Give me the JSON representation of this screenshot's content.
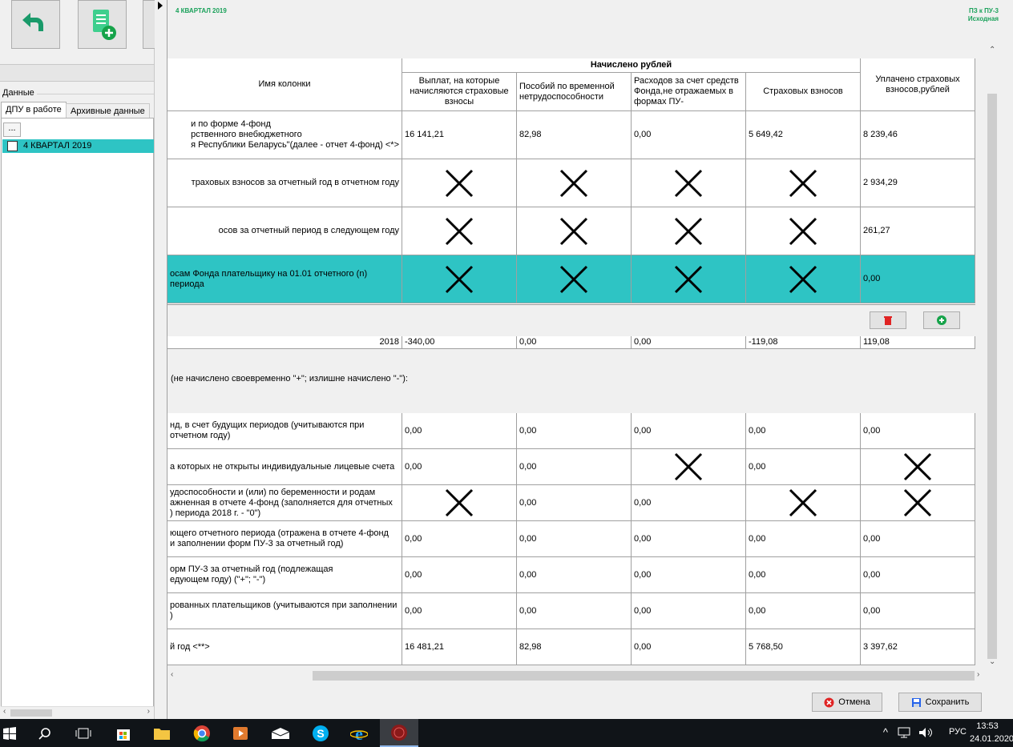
{
  "left_panel": {
    "data_label": "Данные",
    "tabs": [
      "ДПУ в работе",
      "Архивные данные"
    ],
    "tree_button": "...",
    "tree_items": [
      "4 КВАРТАЛ 2019"
    ]
  },
  "header": {
    "period": "4 КВАРТАЛ 2019",
    "form": "ПЗ к ПУ-3",
    "status": "Исходная"
  },
  "table": {
    "col_name": "Имя колонки",
    "group_header": "Начислено рублей",
    "columns": [
      "Выплат, на которые начисляются страховые взносы",
      "Пособий по временной нетрудоспособности",
      "Расходов за счет средств Фонда,не отражаемых в формах ПУ-",
      "Страховых взносов",
      "Уплачено страховых взносов,рублей"
    ],
    "top_rows": [
      {
        "name": "и по форме 4-фонд\nрственного внебюджетного\nя Республики Беларусь\"(далее - отчет 4-фонд) <*>",
        "v": [
          "16 141,21",
          "82,98",
          "0,00",
          "5 649,42",
          "8 239,46"
        ]
      },
      {
        "name": "траховых взносов за отчетный год в отчетном году",
        "v": [
          "X",
          "X",
          "X",
          "X",
          "2 934,29"
        ]
      },
      {
        "name": "осов за отчетный период в следующем году",
        "v": [
          "X",
          "X",
          "X",
          "X",
          "261,27"
        ]
      },
      {
        "name": "осам Фонда плательщику на 01.01 отчетного (n) периода",
        "v": [
          "X",
          "X",
          "X",
          "X",
          "0,00"
        ]
      }
    ],
    "insert_text": "(не начислено своевременно \"+\"; излишне начислено \"-\"):",
    "year_row": {
      "year": "2018",
      "v": [
        "-340,00",
        "0,00",
        "0,00",
        "-119,08",
        "119,08"
      ]
    },
    "bottom_rows": [
      {
        "name": "нд, в счет будущих периодов (учитываются при\nотчетном году)",
        "v": [
          "0,00",
          "0,00",
          "0,00",
          "0,00",
          "0,00"
        ]
      },
      {
        "name": "а которых не открыты индивидуальные лицевые счета",
        "v": [
          "0,00",
          "0,00",
          "X",
          "0,00",
          "X"
        ]
      },
      {
        "name": "удоспособности и (или) по беременности и родам\nажненная в отчете 4-фонд (заполняется для отчетных\n) периода 2018 г. - \"0\")",
        "v": [
          "X",
          "0,00",
          "0,00",
          "X",
          "X"
        ]
      },
      {
        "name": "ющего отчетного периода (отражена в отчете 4-фонд\nи заполнении форм ПУ-3 за отчетный год)",
        "v": [
          "0,00",
          "0,00",
          "0,00",
          "0,00",
          "0,00"
        ]
      },
      {
        "name": "орм ПУ-3 за отчетный год (подлежащая\nедующем году) (\"+\"; \"-\")",
        "v": [
          "0,00",
          "0,00",
          "0,00",
          "0,00",
          "0,00"
        ]
      },
      {
        "name": "рованных плательщиков (учитываются при заполнении\n)",
        "v": [
          "0,00",
          "0,00",
          "0,00",
          "0,00",
          "0,00"
        ]
      },
      {
        "name": "й год <**>",
        "v": [
          "16 481,21",
          "82,98",
          "0,00",
          "5 768,50",
          "3 397,62"
        ]
      }
    ]
  },
  "buttons": {
    "cancel": "Отмена",
    "save": "Сохранить"
  },
  "taskbar": {
    "lang": "РУС",
    "time": "13:53",
    "date": "24.01.2020"
  },
  "colors": {
    "accent": "#2ec4c4",
    "header_green": "#1aa15a"
  }
}
